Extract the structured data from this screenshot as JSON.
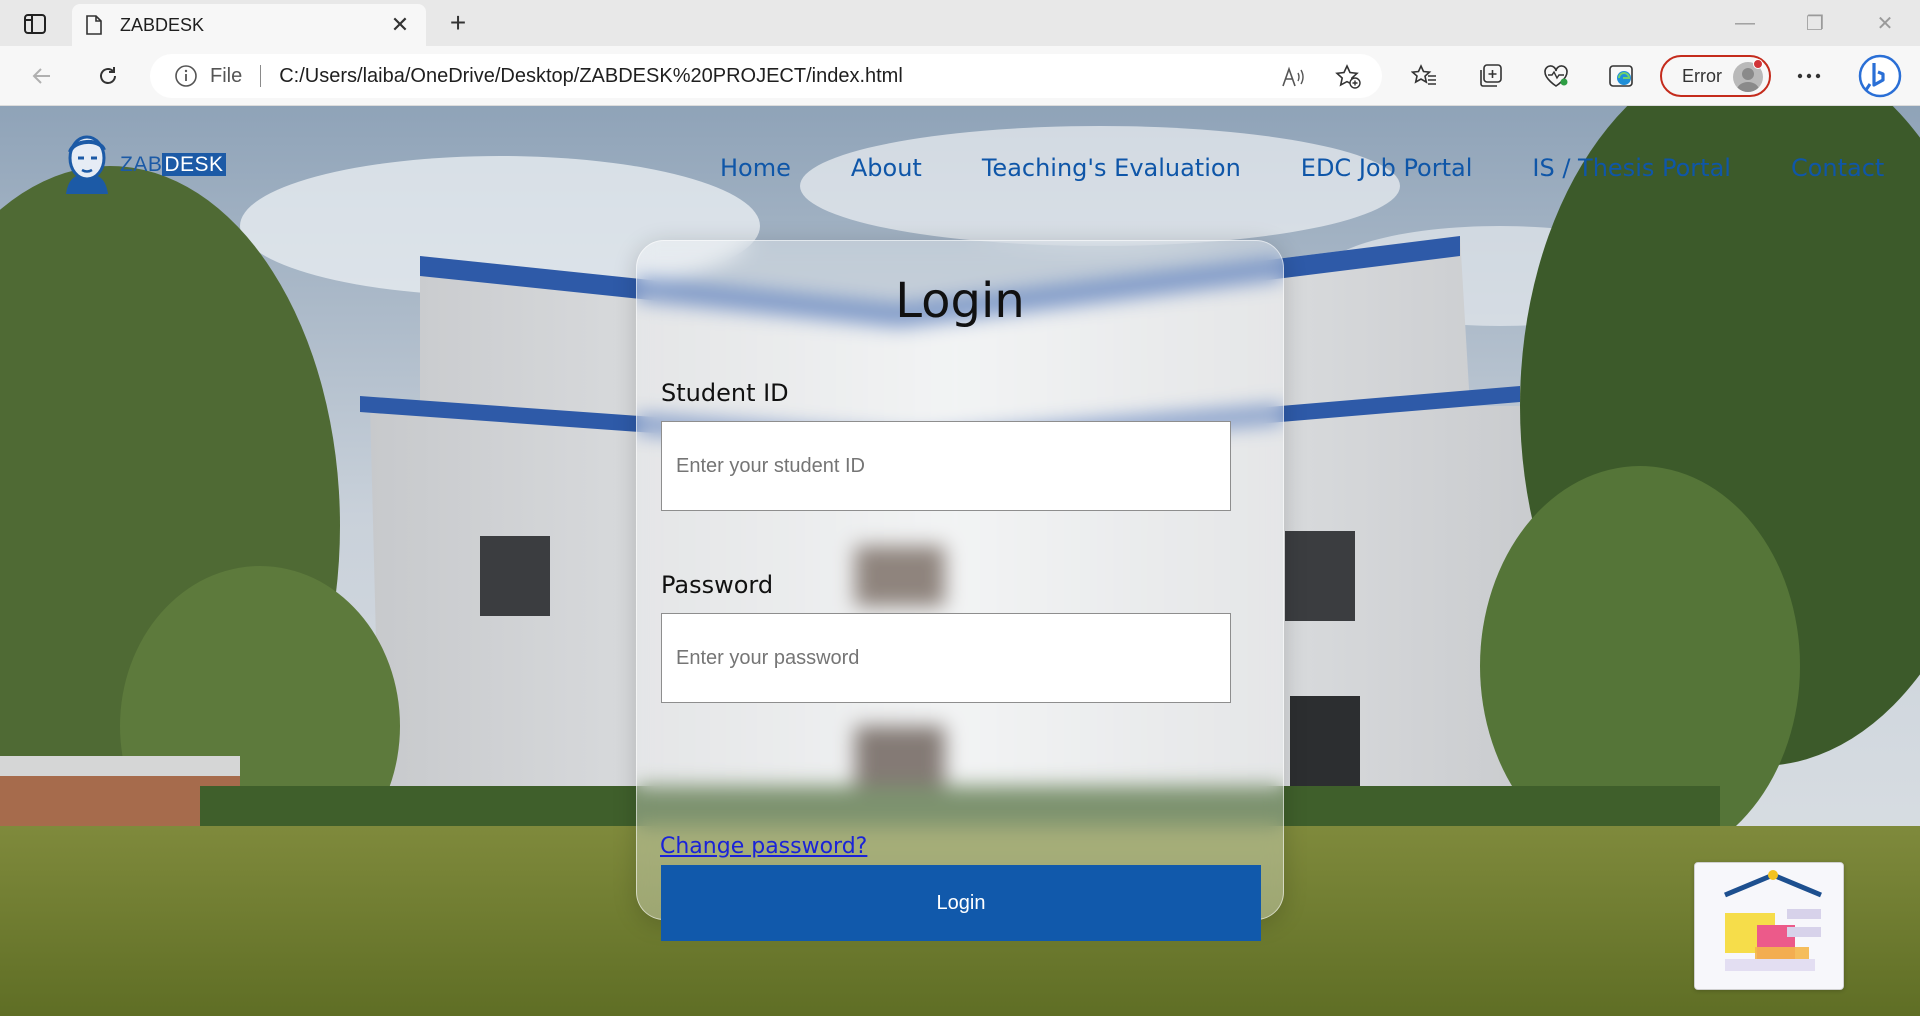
{
  "browser": {
    "tab_title": "ZABDESK",
    "address_scheme_label": "File",
    "url": "C:/Users/laiba/OneDrive/Desktop/ZABDESK%20PROJECT/index.html",
    "profile_status": "Error"
  },
  "site": {
    "logo_prefix": "ZAB",
    "logo_highlight": "DESK",
    "nav": [
      "Home",
      "About",
      "Teaching's Evaluation",
      "EDC Job Portal",
      "IS / Thesis Portal",
      "Contact"
    ]
  },
  "login": {
    "title": "Login",
    "student_id_label": "Student ID",
    "student_id_placeholder": "Enter your student ID",
    "password_label": "Password",
    "password_placeholder": "Enter your password",
    "submit_label": "Login",
    "change_password_link": "Change password?"
  },
  "colors": {
    "accent": "#1159ab",
    "nav_link": "#0f56a8",
    "link": "#1a23d8",
    "error": "#c42b1c"
  }
}
